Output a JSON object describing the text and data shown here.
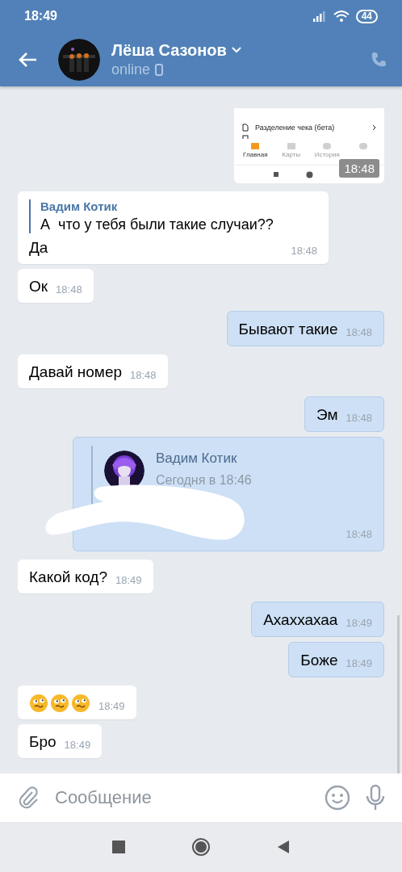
{
  "status_bar": {
    "time": "18:49",
    "battery": "44"
  },
  "header": {
    "name": "Лёша Сазонов",
    "status": "online"
  },
  "messages": [
    {
      "outgoing": true,
      "time": "18:48",
      "screenshot": {
        "menu_item": "Разделение чека (бета)",
        "tabs": [
          {
            "label": "Главная",
            "selected": true
          },
          {
            "label": "Карты",
            "selected": false
          },
          {
            "label": "История",
            "selected": false
          },
          {
            "selected": false
          }
        ]
      }
    },
    {
      "kind": "reply",
      "outgoing": false,
      "reply_author": "Вадим Котик",
      "reply_text": "А  что у тебя были такие случаи??",
      "text": "Да",
      "time": "18:48"
    },
    {
      "kind": "text",
      "outgoing": false,
      "text": "Ок",
      "time": "18:48"
    },
    {
      "kind": "text",
      "outgoing": true,
      "text": "Бывают такие",
      "time": "18:48"
    },
    {
      "kind": "text",
      "outgoing": false,
      "text": "Давай номер",
      "time": "18:48"
    },
    {
      "kind": "text",
      "outgoing": true,
      "text": "Эм",
      "time": "18:48"
    },
    {
      "kind": "forward",
      "outgoing": true,
      "forward_author": "Вадим Котик",
      "forward_date": "Сегодня в 18:46",
      "time": "18:48"
    },
    {
      "kind": "text",
      "outgoing": false,
      "text": "Какой код?",
      "time": "18:49"
    },
    {
      "kind": "text",
      "outgoing": true,
      "text": "Ахаххахаа",
      "time": "18:49"
    },
    {
      "kind": "text",
      "outgoing": true,
      "text": "Боже",
      "time": "18:49"
    },
    {
      "kind": "emoji",
      "outgoing": false,
      "emojis": [
        {
          "kind": "woozy"
        },
        {
          "kind": "woozy"
        },
        {
          "kind": "woozy"
        }
      ],
      "time": "18:49"
    },
    {
      "kind": "text",
      "outgoing": false,
      "text": "Бро",
      "time": "18:49"
    }
  ],
  "composer": {
    "placeholder": "Сообщение"
  }
}
